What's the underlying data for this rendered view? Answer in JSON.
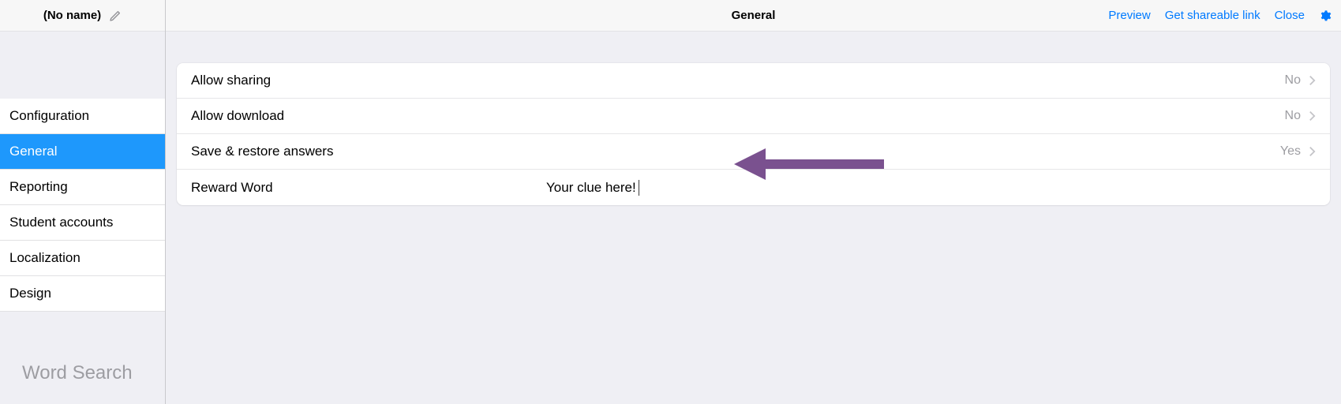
{
  "sidebar": {
    "title": "(No name)",
    "items": [
      {
        "label": "Configuration",
        "active": false
      },
      {
        "label": "General",
        "active": true
      },
      {
        "label": "Reporting",
        "active": false
      },
      {
        "label": "Student accounts",
        "active": false
      },
      {
        "label": "Localization",
        "active": false
      },
      {
        "label": "Design",
        "active": false
      }
    ],
    "footer": "Word Search"
  },
  "topbar": {
    "title": "General",
    "links": {
      "preview": "Preview",
      "share": "Get shareable link",
      "close": "Close"
    }
  },
  "settings": {
    "sharing": {
      "label": "Allow sharing",
      "value": "No"
    },
    "download": {
      "label": "Allow download",
      "value": "No"
    },
    "restore": {
      "label": "Save & restore answers",
      "value": "Yes"
    },
    "reward": {
      "label": "Reward Word",
      "placeholder": "Your clue here!",
      "value": "Your clue here!"
    }
  }
}
